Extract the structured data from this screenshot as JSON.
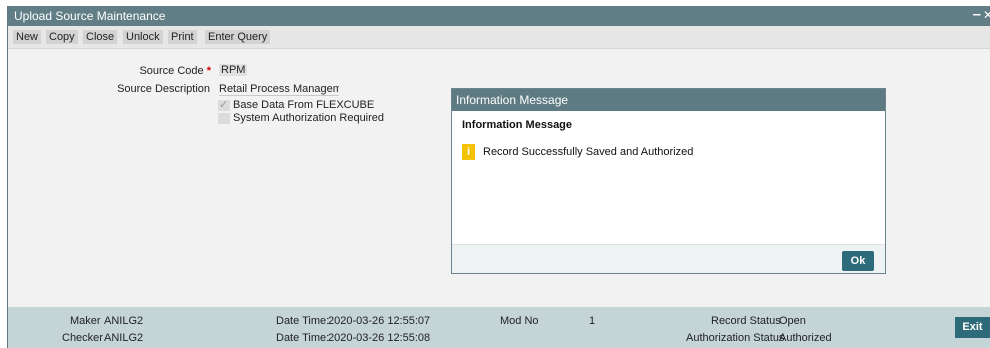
{
  "window": {
    "title": "Upload Source Maintenance",
    "minimize_glyph": "–",
    "close_glyph": "✕"
  },
  "toolbar": {
    "buttons": [
      "New",
      "Copy",
      "Close",
      "Unlock",
      "Print",
      "Enter Query"
    ]
  },
  "form": {
    "source_code_label": "Source Code",
    "required_mark": "*",
    "source_code_value": "RPM",
    "source_description_label": "Source Description",
    "source_description_value": "Retail Process Management",
    "base_data_label": "Base Data From FLEXCUBE",
    "base_data_checked": true,
    "sys_auth_label": "System Authorization Required",
    "sys_auth_checked": false
  },
  "dialog": {
    "title": "Information Message",
    "heading": "Information Message",
    "icon": "info-icon",
    "message": "Record Successfully Saved and Authorized",
    "ok_label": "Ok"
  },
  "audit": {
    "maker_label": "Maker",
    "maker_value": "ANILG2",
    "checker_label": "Checker",
    "checker_value": "ANILG2",
    "maker_dt_label": "Date Time:",
    "maker_dt_value": "2020-03-26 12:55:07",
    "checker_dt_label": "Date Time:",
    "checker_dt_value": "2020-03-26 12:55:08",
    "mod_no_label": "Mod No",
    "mod_no_value": "1",
    "record_status_label": "Record Status",
    "record_status_value": "Open",
    "auth_status_label": "Authorization Status",
    "auth_status_value": "Authorized",
    "exit_label": "Exit"
  }
}
